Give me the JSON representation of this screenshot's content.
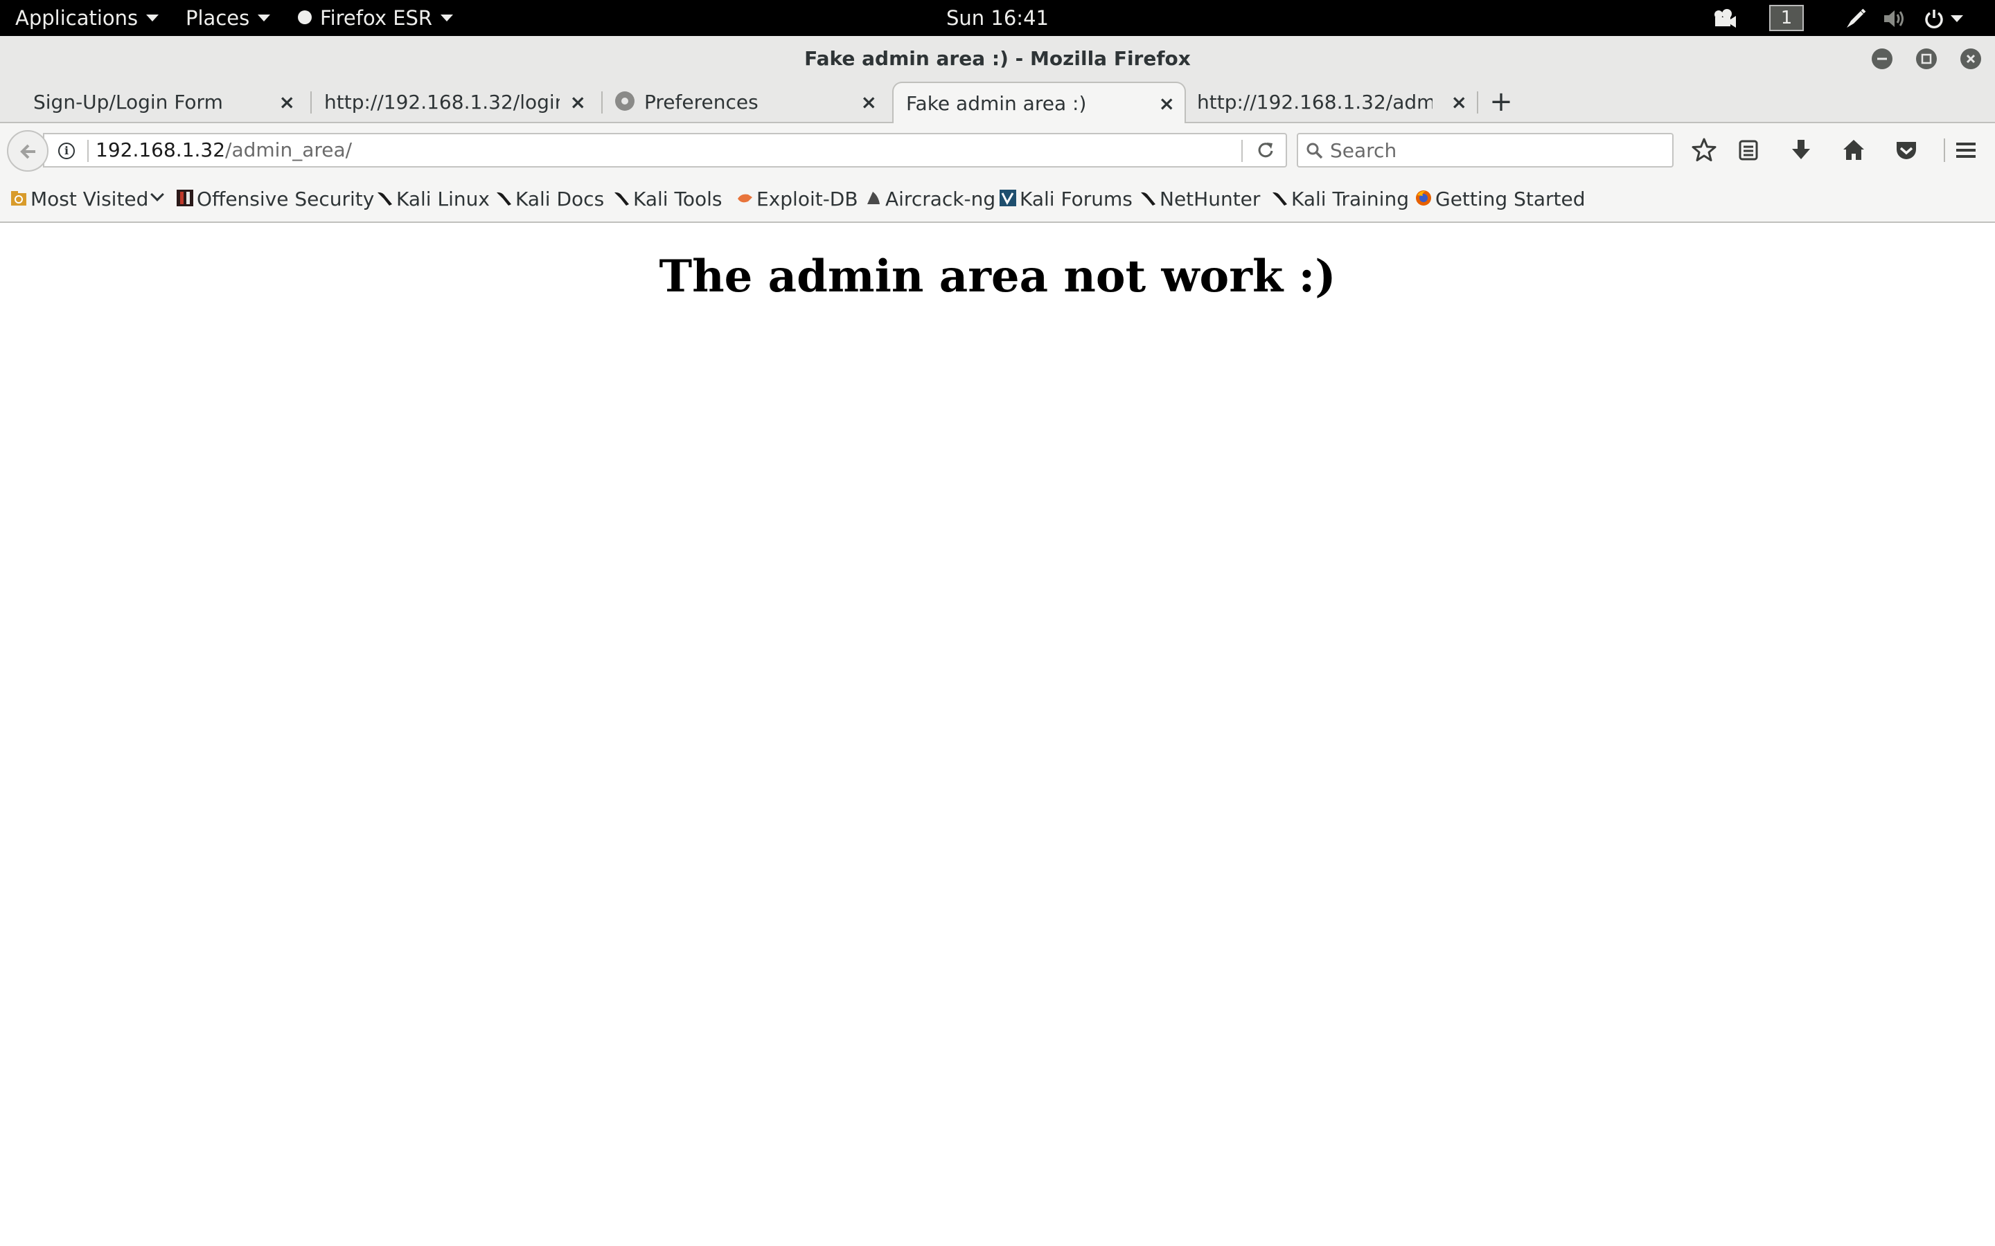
{
  "topbar": {
    "applications": "Applications",
    "places": "Places",
    "app_menu": "Firefox ESR",
    "clock": "Sun 16:41",
    "workspace": "1"
  },
  "window": {
    "title": "Fake admin area :) - Mozilla Firefox"
  },
  "tabs": [
    {
      "label": "Sign-Up/Login Form",
      "active": false
    },
    {
      "label": "http://192.168.1.32/login...",
      "active": false
    },
    {
      "label": "Preferences",
      "active": false,
      "icon": "gear-icon"
    },
    {
      "label": "Fake admin area :)",
      "active": true
    },
    {
      "label": "http://192.168.1.32/admi...",
      "active": false
    }
  ],
  "tab_close_glyph": "×",
  "new_tab_glyph": "+",
  "navbar": {
    "url_host": "192.168.1.32",
    "url_path": "/admin_area/",
    "search_placeholder": "Search"
  },
  "bookmarks": [
    {
      "label": "Most Visited",
      "icon": "most-visited-icon"
    },
    {
      "label": "Offensive Security",
      "icon": "offsec-icon"
    },
    {
      "label": "Kali Linux",
      "icon": "kali-dragon-icon"
    },
    {
      "label": "Kali Docs",
      "icon": "kali-dragon-icon"
    },
    {
      "label": "Kali Tools",
      "icon": "kali-dragon-icon"
    },
    {
      "label": "Exploit-DB",
      "icon": "exploit-db-icon"
    },
    {
      "label": "Aircrack-ng",
      "icon": "aircrack-icon"
    },
    {
      "label": "Kali Forums",
      "icon": "kali-forums-icon"
    },
    {
      "label": "NetHunter",
      "icon": "kali-dragon-icon"
    },
    {
      "label": "Kali Training",
      "icon": "kali-dragon-icon"
    },
    {
      "label": "Getting Started",
      "icon": "firefox-icon"
    }
  ],
  "page": {
    "heading": "The admin area not work :)"
  }
}
